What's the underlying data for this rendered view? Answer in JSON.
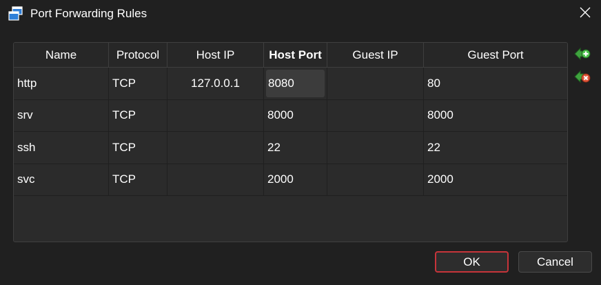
{
  "window": {
    "title": "Port Forwarding Rules"
  },
  "icons": {
    "app": "vm-window-icon",
    "close": "close-icon",
    "add_rule": "add-rule-icon",
    "remove_rule": "remove-rule-icon"
  },
  "table": {
    "headers": [
      "Name",
      "Protocol",
      "Host IP",
      "Host Port",
      "Guest IP",
      "Guest Port"
    ],
    "rows": [
      {
        "name": "http",
        "protocol": "TCP",
        "host_ip": "127.0.0.1",
        "host_port": "8080",
        "guest_ip": "",
        "guest_port": "80"
      },
      {
        "name": "srv",
        "protocol": "TCP",
        "host_ip": "",
        "host_port": "8000",
        "guest_ip": "",
        "guest_port": "8000"
      },
      {
        "name": "ssh",
        "protocol": "TCP",
        "host_ip": "",
        "host_port": "22",
        "guest_ip": "",
        "guest_port": "22"
      },
      {
        "name": "svc",
        "protocol": "TCP",
        "host_ip": "",
        "host_port": "2000",
        "guest_ip": "",
        "guest_port": "2000"
      }
    ]
  },
  "buttons": {
    "ok": "OK",
    "cancel": "Cancel"
  },
  "colors": {
    "background": "#202020",
    "ok_border": "#c7343a",
    "add_icon": "#3fa33f",
    "remove_icon": "#d9452e"
  }
}
